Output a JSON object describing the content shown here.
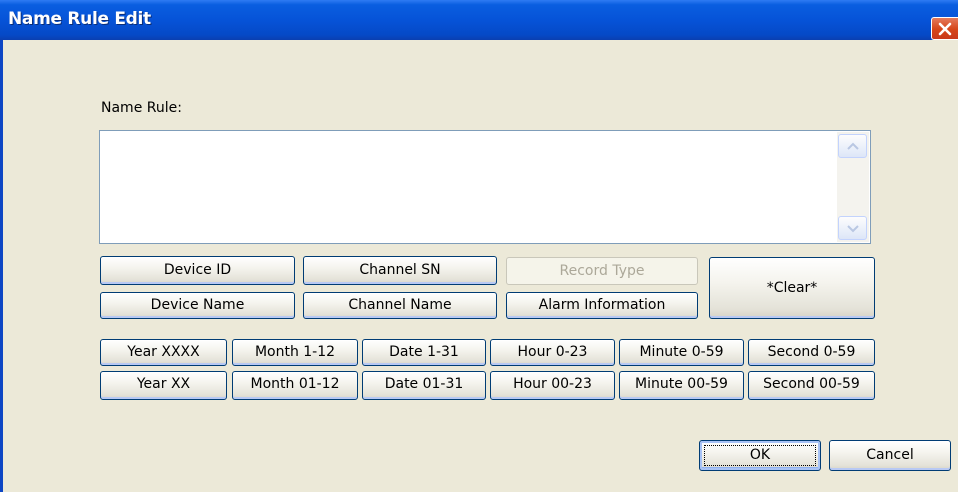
{
  "window": {
    "title": "Name Rule Edit"
  },
  "form": {
    "name_rule_label": "Name Rule:",
    "name_rule_value": ""
  },
  "field_buttons": {
    "device_id": "Device ID",
    "channel_sn": "Channel SN",
    "record_type": "Record Type",
    "device_name": "Device Name",
    "channel_name": "Channel Name",
    "alarm_information": "Alarm Information",
    "clear": "*Clear*"
  },
  "time_buttons": {
    "row1": [
      "Year XXXX",
      "Month 1-12",
      "Date 1-31",
      "Hour 0-23",
      "Minute 0-59",
      "Second 0-59"
    ],
    "row2": [
      "Year XX",
      "Month 01-12",
      "Date 01-31",
      "Hour 00-23",
      "Minute 00-59",
      "Second 00-59"
    ]
  },
  "dialog_buttons": {
    "ok": "OK",
    "cancel": "Cancel"
  },
  "icons": {
    "close": "close-icon",
    "scroll_up": "arrow-up-icon",
    "scroll_down": "arrow-down-icon"
  },
  "colors": {
    "titlebar": "#0653d8",
    "close_button": "#d64518",
    "dialog_background": "#ece9d8",
    "button_border": "#003c74",
    "disabled_text": "#aca899"
  },
  "state": {
    "record_type_enabled": false,
    "default_button": "ok"
  }
}
